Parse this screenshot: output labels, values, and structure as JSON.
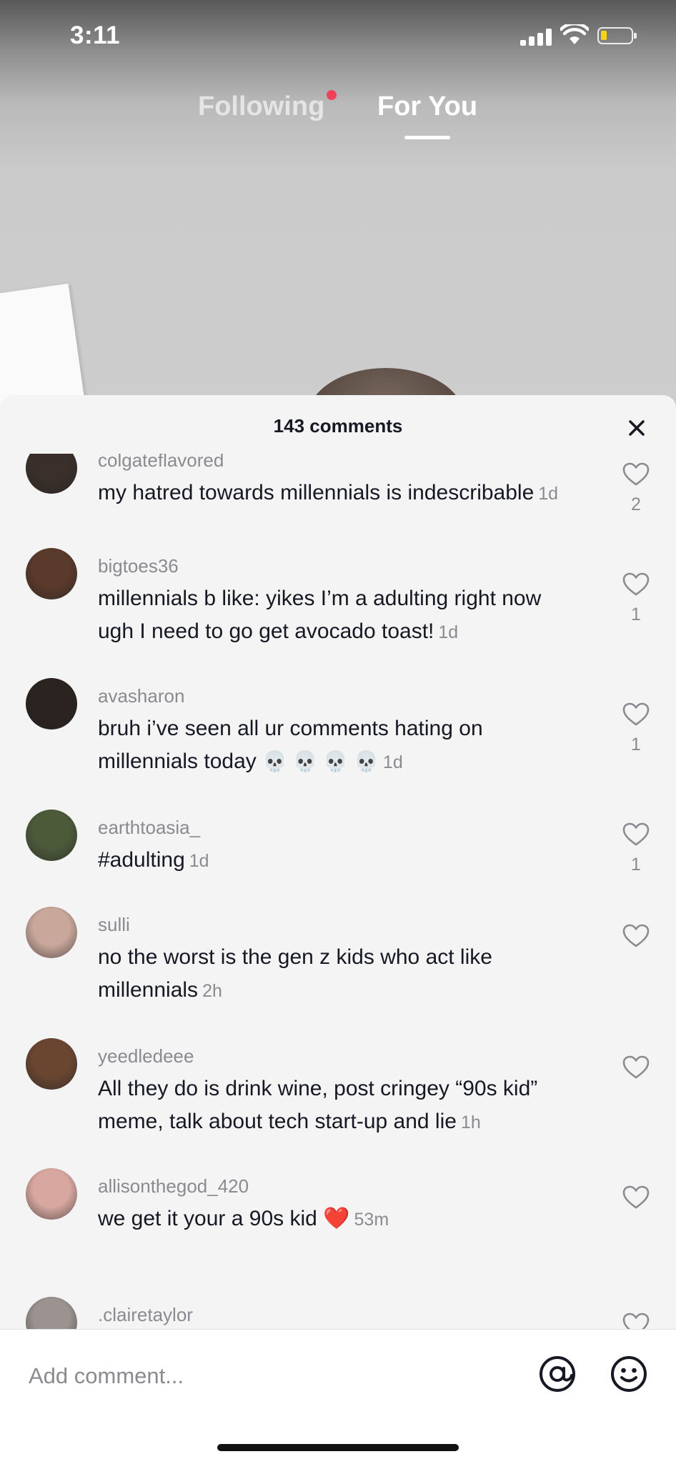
{
  "status_bar": {
    "time": "3:11"
  },
  "tabs": [
    {
      "label": "Following",
      "has_dot": true
    },
    {
      "label": "For You",
      "active": true
    }
  ],
  "sheet": {
    "title": "143 comments"
  },
  "comments": [
    {
      "username": "colgateflavored",
      "text": "my hatred towards millennials is indescribable",
      "time": "1d",
      "likes": "2",
      "avatar_color": "#3a2f2a"
    },
    {
      "username": "bigtoes36",
      "text": "millennials b like: yikes I’m a  adulting right now ugh I need to go get avocado toast!",
      "time": "1d",
      "likes": "1",
      "avatar_color": "#5a3a2a"
    },
    {
      "username": "avasharon",
      "text": "bruh i’ve seen all ur comments hating on millennials today",
      "emoji": "💀 💀 💀 💀",
      "time": "1d",
      "likes": "1",
      "avatar_color": "#2b2320"
    },
    {
      "username": "earthtoasia_",
      "text": "#adulting",
      "time": "1d",
      "likes": "1",
      "avatar_color": "#4c5a3a"
    },
    {
      "username": "sulli",
      "text": "no the worst is the gen z kids who act like millennials",
      "time": "2h",
      "likes": "",
      "avatar_color": "#c9a79a"
    },
    {
      "username": "yeedledeee",
      "text": "All they do is drink wine, post cringey “90s kid” meme, talk about tech start-up and lie",
      "time": "1h",
      "likes": "",
      "avatar_color": "#6a4630"
    },
    {
      "username": "allisonthegod_420",
      "text": "we get it your a 90s kid",
      "emoji": "❤️",
      "time": "53m",
      "likes": "",
      "avatar_color": "#d8a8a0"
    },
    {
      "username": ".clairetaylor",
      "text": "",
      "time": "",
      "likes": "",
      "avatar_color": "#9c9390"
    }
  ],
  "comment_bar": {
    "placeholder": "Add comment..."
  },
  "icons": {
    "close": "close-icon",
    "heart": "heart-outline-icon",
    "mention": "at-sign-icon",
    "emoji": "smiley-icon"
  },
  "colors": {
    "text_primary": "#161823",
    "text_secondary": "#8a8b91",
    "notification_dot": "#f3415b",
    "battery_low": "#f5d60a"
  }
}
